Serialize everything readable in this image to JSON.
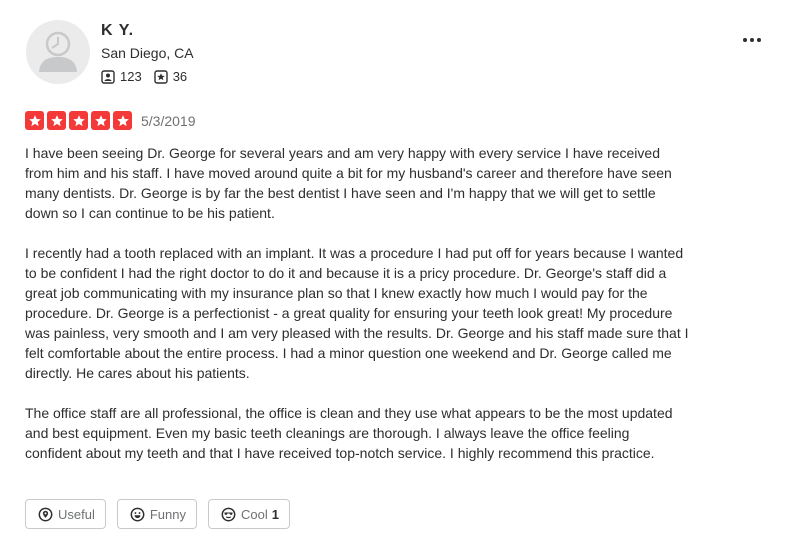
{
  "user": {
    "name": "K Y.",
    "location": "San Diego, CA",
    "friends_count": "123",
    "reviews_count": "36"
  },
  "review": {
    "rating": 5,
    "rating_max": 5,
    "date": "5/3/2019",
    "paragraphs": [
      "I have been seeing Dr. George for several years and am very happy with every service I have received from him and his staff.  I have moved around quite a bit for my husband's career and therefore have seen many dentists.  Dr. George is by far the best dentist I have seen and I'm happy that we will get to settle down so I can continue to be his patient.",
      "I recently had a tooth replaced with an implant. It was a procedure I had put off for years because I wanted to be confident I had the right doctor to do it and because it is a pricy procedure. Dr. George's staff did a great job communicating with my insurance plan so that I knew exactly how much I would pay for the procedure. Dr. George is a perfectionist - a great quality for ensuring your teeth look great! My procedure was painless, very smooth and I am very pleased with the results. Dr. George and his staff made sure that I felt comfortable about the entire process. I had a minor question one weekend and Dr. George called me directly. He cares about his patients.",
      "The office staff are all professional, the office is clean and they use what appears to be the most updated and best equipment. Even my basic teeth cleanings are thorough.  I always leave the office feeling confident about my teeth and that I have received top-notch service. I highly recommend this practice."
    ]
  },
  "actions": {
    "useful_label": "Useful",
    "funny_label": "Funny",
    "cool_label": "Cool",
    "cool_count": "1"
  },
  "icons": {
    "avatar": "default-avatar-icon",
    "friends": "friends-icon",
    "reviews": "review-star-icon",
    "more": "more-options-icon",
    "star": "star-icon",
    "useful": "useful-icon",
    "funny": "funny-icon",
    "cool": "cool-icon"
  },
  "colors": {
    "star_fill": "#f43939",
    "text": "#2d2e2f",
    "muted": "#6e7072",
    "border": "#c8c9ca",
    "avatar_bg": "#ebebeb"
  }
}
